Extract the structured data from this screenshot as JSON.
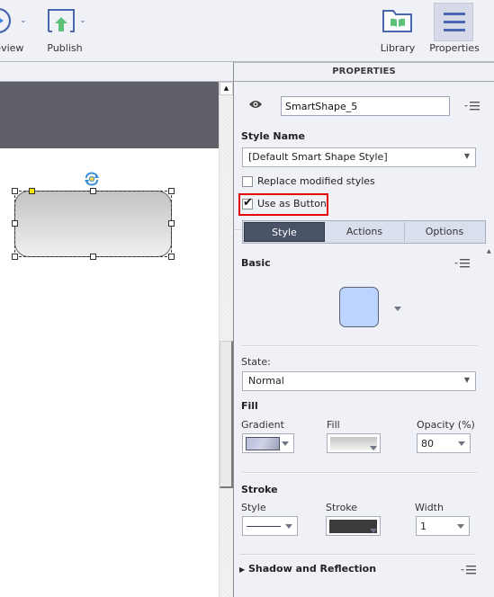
{
  "toolbar": {
    "preview_label": "Preview",
    "publish_label": "Publish",
    "library_label": "Library",
    "properties_label": "Properties"
  },
  "panel": {
    "title": "PROPERTIES",
    "object_name": "SmartShape_5",
    "style_name_heading": "Style Name",
    "style_name_value": "[Default Smart Shape Style]",
    "replace_modified_label": "Replace modified styles",
    "replace_modified_checked": false,
    "use_as_button_label": "Use as Button",
    "use_as_button_checked": true,
    "tabs": [
      {
        "label": "Style",
        "active": true
      },
      {
        "label": "Actions",
        "active": false
      },
      {
        "label": "Options",
        "active": false
      }
    ],
    "basic_heading": "Basic",
    "basic_swatch_color": "#bcd4ff",
    "state_label": "State:",
    "state_value": "Normal",
    "fill_heading": "Fill",
    "gradient_label": "Gradient",
    "fill_label": "Fill",
    "opacity_label": "Opacity (%)",
    "opacity_value": "80",
    "stroke_heading": "Stroke",
    "stroke_style_label": "Style",
    "stroke_color_label": "Stroke",
    "stroke_color": "#3b3b3b",
    "width_label": "Width",
    "width_value": "1",
    "shadow_heading": "Shadow and Reflection"
  },
  "colors": {
    "highlight_box": "#e5000a",
    "active_tab": "#4b5369",
    "publish_arrow": "#5cc27a",
    "icon_blue": "#4a66b0"
  }
}
